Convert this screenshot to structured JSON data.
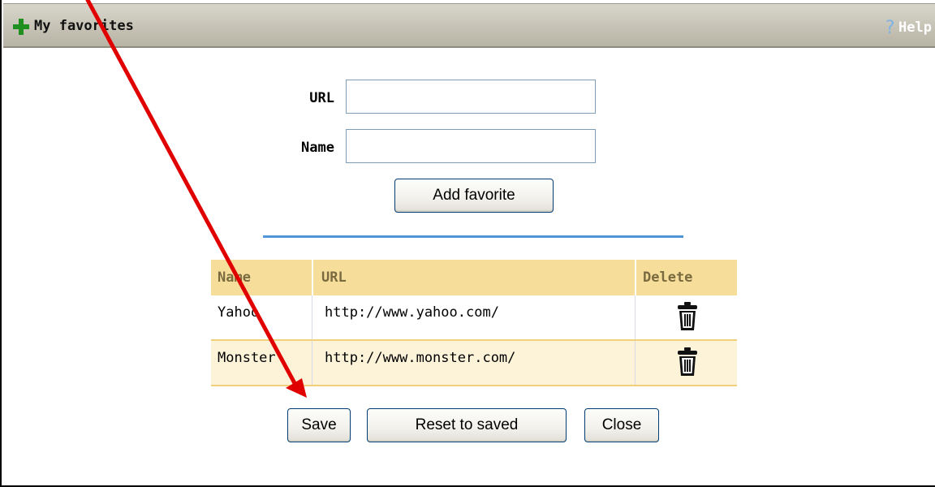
{
  "header": {
    "title": "My favorites",
    "help_label": "Help",
    "icon": "plus-icon",
    "help_icon": "question-icon"
  },
  "form": {
    "url_label": "URL",
    "url_value": "",
    "name_label": "Name",
    "name_value": "",
    "add_button_label": "Add favorite"
  },
  "table": {
    "columns": [
      "Name",
      "URL",
      "Delete"
    ],
    "rows": [
      {
        "name": "Yahoo",
        "url": "http://www.yahoo.com/",
        "delete_icon": "trash-icon"
      },
      {
        "name": "Monster",
        "url": "http://www.monster.com/",
        "delete_icon": "trash-icon"
      }
    ]
  },
  "actions": {
    "save_label": "Save",
    "reset_label": "Reset to saved",
    "close_label": "Close"
  },
  "colors": {
    "accent_blue": "#4f95d8",
    "table_header_bg": "#f6dd9a",
    "annotation_arrow": "#e00000"
  }
}
